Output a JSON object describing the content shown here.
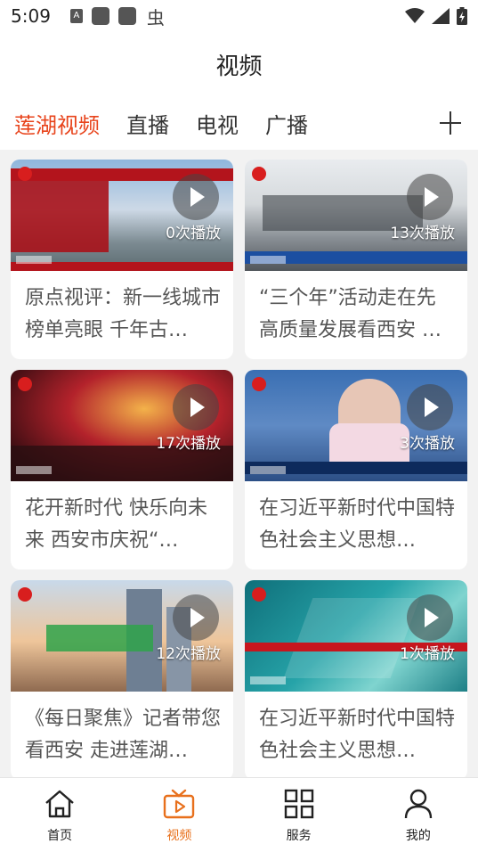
{
  "status_bar": {
    "time": "5:09",
    "app_icon_a": "A",
    "app_icon_ch": "虫"
  },
  "header": {
    "title": "视频"
  },
  "tabs": [
    {
      "label": "莲湖视频",
      "active": true
    },
    {
      "label": "直播",
      "active": false
    },
    {
      "label": "电视",
      "active": false
    },
    {
      "label": "广播",
      "active": false
    }
  ],
  "add_tab_icon": "plus-icon",
  "accent_color": "#e8441c",
  "videos": [
    {
      "title": "原点视评：新一线城市榜单亮眼  千年古…",
      "plays": "0次播放"
    },
    {
      "title": "“三个年”活动走在先  高质量发展看西安 …",
      "plays": "13次播放"
    },
    {
      "title": "花开新时代  快乐向未来  西安市庆祝“…",
      "plays": "17次播放"
    },
    {
      "title": "在习近平新时代中国特色社会主义思想…",
      "plays": "3次播放"
    },
    {
      "title": "《每日聚焦》记者带您看西安  走进莲湖…",
      "plays": "12次播放"
    },
    {
      "title": "在习近平新时代中国特色社会主义思想…",
      "plays": "1次播放"
    }
  ],
  "bottom_nav": [
    {
      "label": "首页",
      "icon": "home-icon",
      "active": false
    },
    {
      "label": "视频",
      "icon": "video-icon",
      "active": true
    },
    {
      "label": "服务",
      "icon": "grid-icon",
      "active": false
    },
    {
      "label": "我的",
      "icon": "user-icon",
      "active": false
    }
  ]
}
